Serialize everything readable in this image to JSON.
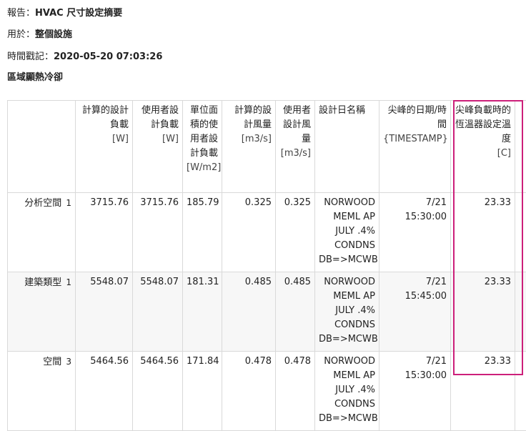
{
  "meta": {
    "report_label": "報告：",
    "report_value": "HVAC 尺寸設定摘要",
    "for_label": "用於：",
    "for_value": "整個設施",
    "timestamp_label": "時間戳記：",
    "timestamp_value": "2020-05-20 07:03:26",
    "section_title": "區域顯熱冷卻"
  },
  "table": {
    "headers": [
      {
        "text": "",
        "unit": ""
      },
      {
        "text": "計算的設計負載",
        "unit": "[W]"
      },
      {
        "text": "使用者設計負載",
        "unit": "[W]"
      },
      {
        "text": "單位面積的使用者設計負載",
        "unit": "[W/m2]"
      },
      {
        "text": "計算的設計風量",
        "unit": "[m3/s]"
      },
      {
        "text": "使用者設計風量",
        "unit": "[m3/s]"
      },
      {
        "text": "設計日名稱",
        "unit": ""
      },
      {
        "text": "尖峰的日期/時間",
        "unit": "{TIMESTAMP}"
      },
      {
        "text": "尖峰負載時的恆溫器設定溫度",
        "unit": "[C]"
      },
      {
        "text": "尖",
        "unit": ""
      }
    ],
    "rows": [
      {
        "name": "分析空間",
        "index": "1",
        "cells": [
          "3715.76",
          "3715.76",
          "185.79",
          "0.325",
          "0.325",
          "NORWOOD MEML AP JULY .4% CONDNS DB=>MCWB",
          "7/21 15:30:00",
          "23.33",
          ""
        ]
      },
      {
        "name": "建築類型",
        "index": "1",
        "cells": [
          "5548.07",
          "5548.07",
          "181.31",
          "0.485",
          "0.485",
          "NORWOOD MEML AP JULY .4% CONDNS DB=>MCWB",
          "7/21 15:45:00",
          "23.33",
          ""
        ]
      },
      {
        "name": "空間",
        "index": "3",
        "cells": [
          "5464.56",
          "5464.56",
          "171.84",
          "0.478",
          "0.478",
          "NORWOOD MEML AP JULY .4% CONDNS DB=>MCWB",
          "7/21 15:30:00",
          "23.33",
          ""
        ]
      }
    ]
  },
  "colors": {
    "highlight_border": "#cc1f7a",
    "grid_line": "#d9d9d9",
    "alt_row": "#f7f7f7"
  }
}
